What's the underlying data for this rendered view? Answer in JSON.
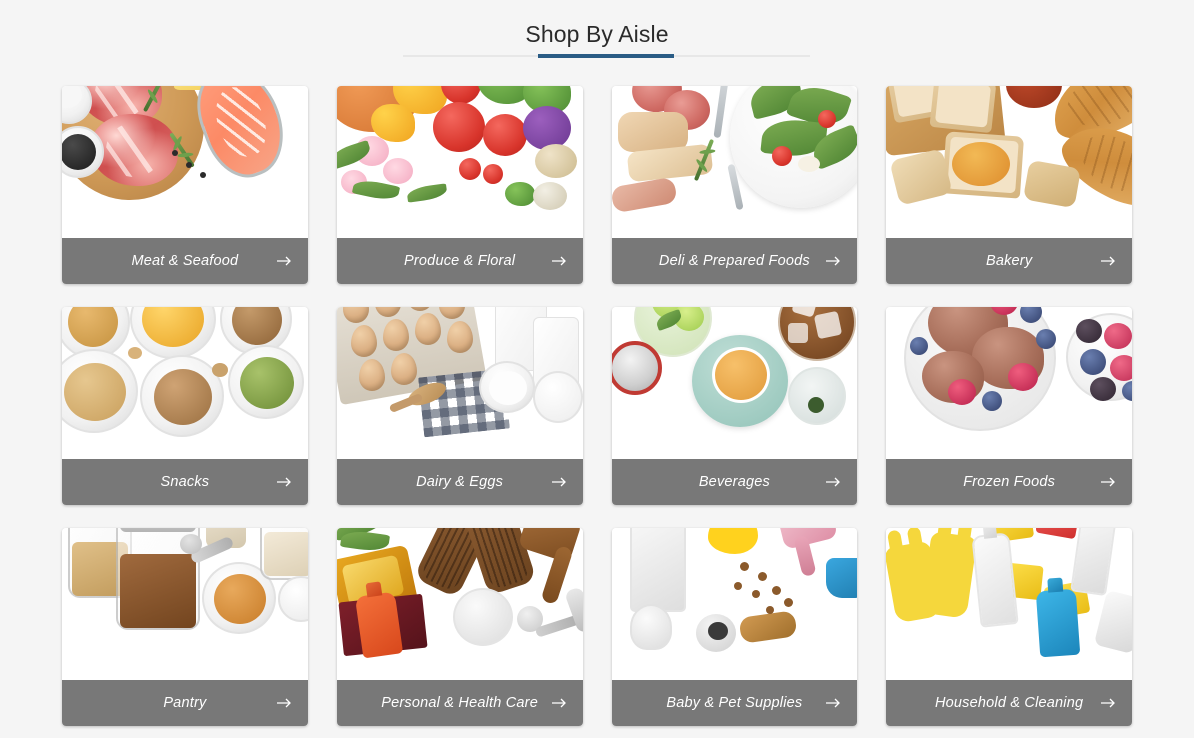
{
  "header": {
    "title": "Shop By Aisle",
    "accent_color": "#2a5c85",
    "rule_color": "#e7e7e7"
  },
  "theme": {
    "page_background": "#f5f5f5",
    "card_background": "#ffffff",
    "label_bar_color": "#787878",
    "label_text_color": "#ffffff"
  },
  "grid": {
    "columns": 4,
    "rows": 3,
    "arrow_icon": "arrow-right-icon"
  },
  "aisles": [
    {
      "label": "Meat & Seafood",
      "image": "meat-and-seafood-photo",
      "arrow": "→"
    },
    {
      "label": "Produce & Floral",
      "image": "produce-and-floral-photo",
      "arrow": "→"
    },
    {
      "label": "Deli & Prepared Foods",
      "image": "deli-and-prepared-foods-photo",
      "arrow": "→"
    },
    {
      "label": "Bakery",
      "image": "bakery-photo",
      "arrow": "→"
    },
    {
      "label": "Snacks",
      "image": "snacks-photo",
      "arrow": "→"
    },
    {
      "label": "Dairy & Eggs",
      "image": "dairy-and-eggs-photo",
      "arrow": "→"
    },
    {
      "label": "Beverages",
      "image": "beverages-photo",
      "arrow": "→"
    },
    {
      "label": "Frozen Foods",
      "image": "frozen-foods-photo",
      "arrow": "→"
    },
    {
      "label": "Pantry",
      "image": "pantry-photo",
      "arrow": "→"
    },
    {
      "label": "Personal & Health Care",
      "image": "personal-and-health-care-photo",
      "arrow": "→"
    },
    {
      "label": "Baby & Pet Supplies",
      "image": "baby-and-pet-supplies-photo",
      "arrow": "→"
    },
    {
      "label": "Household & Cleaning",
      "image": "household-and-cleaning-photo",
      "arrow": "→"
    }
  ]
}
